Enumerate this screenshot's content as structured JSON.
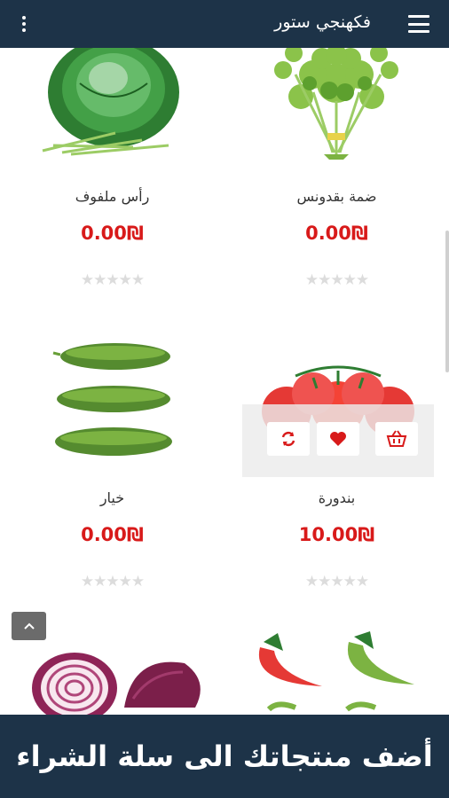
{
  "header": {
    "title": "فكهنجي ستور",
    "menu_icon": "hamburger-icon",
    "more_icon": "kebab-icon"
  },
  "products": [
    {
      "name": "ضمة بقدونس",
      "price": "0.00₪",
      "rating": 0,
      "image": "parsley"
    },
    {
      "name": "رأس ملفوف",
      "price": "0.00₪",
      "rating": 0,
      "image": "cabbage"
    },
    {
      "name": "بندورة",
      "price": "10.00₪",
      "rating": 0,
      "image": "tomato"
    },
    {
      "name": "خيار",
      "price": "0.00₪",
      "rating": 0,
      "image": "cucumber"
    },
    {
      "name": "",
      "price": "",
      "rating": 0,
      "image": "chili-pepper"
    },
    {
      "name": "",
      "price": "",
      "rating": 0,
      "image": "red-onion"
    }
  ],
  "hover_actions": [
    "basket-icon",
    "heart-icon",
    "refresh-icon"
  ],
  "stars": "★★★★★",
  "banner": {
    "text": "أضف منتجاتك الى سلة الشراء"
  },
  "colors": {
    "header_bg": "#1d3348",
    "price": "#d81a1a",
    "stars": "#dcdcdc"
  }
}
